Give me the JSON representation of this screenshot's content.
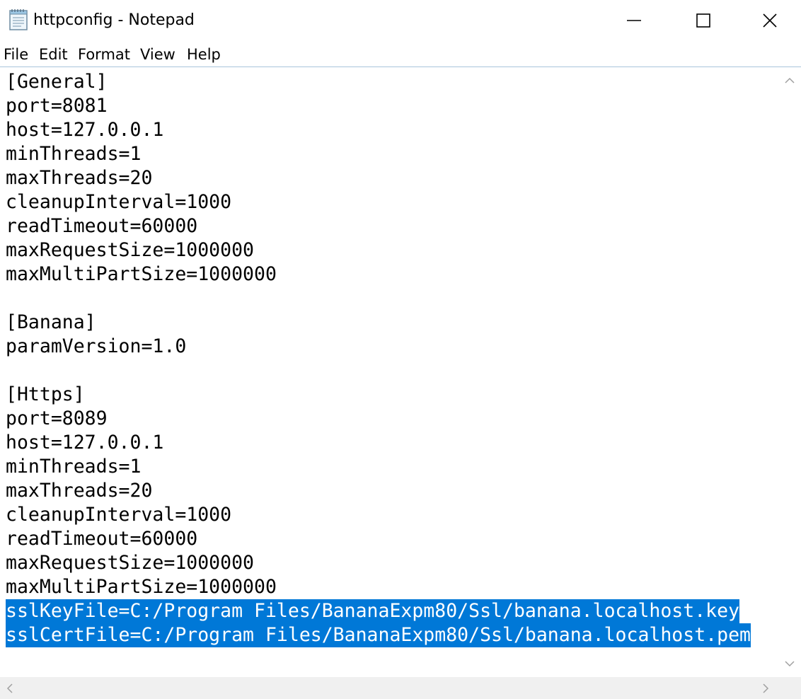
{
  "window": {
    "title": "httpconfig - Notepad",
    "icon": "notepad-icon",
    "controls": [
      "minimize-icon",
      "maximize-icon",
      "close-icon"
    ]
  },
  "menu": {
    "items": [
      {
        "label": "File"
      },
      {
        "label": "Edit"
      },
      {
        "label": "Format"
      },
      {
        "label": "View"
      },
      {
        "label": "Help"
      }
    ]
  },
  "editor": {
    "lines": [
      {
        "text": "[General]",
        "selected": false
      },
      {
        "text": "port=8081",
        "selected": false
      },
      {
        "text": "host=127.0.0.1",
        "selected": false
      },
      {
        "text": "minThreads=1",
        "selected": false
      },
      {
        "text": "maxThreads=20",
        "selected": false
      },
      {
        "text": "cleanupInterval=1000",
        "selected": false
      },
      {
        "text": "readTimeout=60000",
        "selected": false
      },
      {
        "text": "maxRequestSize=1000000",
        "selected": false
      },
      {
        "text": "maxMultiPartSize=1000000",
        "selected": false
      },
      {
        "text": "",
        "selected": false
      },
      {
        "text": "[Banana]",
        "selected": false
      },
      {
        "text": "paramVersion=1.0",
        "selected": false
      },
      {
        "text": "",
        "selected": false
      },
      {
        "text": "[Https]",
        "selected": false
      },
      {
        "text": "port=8089",
        "selected": false
      },
      {
        "text": "host=127.0.0.1",
        "selected": false
      },
      {
        "text": "minThreads=1",
        "selected": false
      },
      {
        "text": "maxThreads=20",
        "selected": false
      },
      {
        "text": "cleanupInterval=1000",
        "selected": false
      },
      {
        "text": "readTimeout=60000",
        "selected": false
      },
      {
        "text": "maxRequestSize=1000000",
        "selected": false
      },
      {
        "text": "maxMultiPartSize=1000000",
        "selected": false
      },
      {
        "text": "sslKeyFile=C:/Program Files/BananaExpm80/Ssl/banana.localhost.key",
        "selected": true
      },
      {
        "text": "sslCertFile=C:/Program Files/BananaExpm80/Ssl/banana.localhost.pem",
        "selected": true
      }
    ]
  },
  "colors": {
    "selection": "#0078d7",
    "selection_text": "#ffffff",
    "menu_border": "#a9c5dc",
    "scrollbar_track": "#f0f0f0"
  }
}
